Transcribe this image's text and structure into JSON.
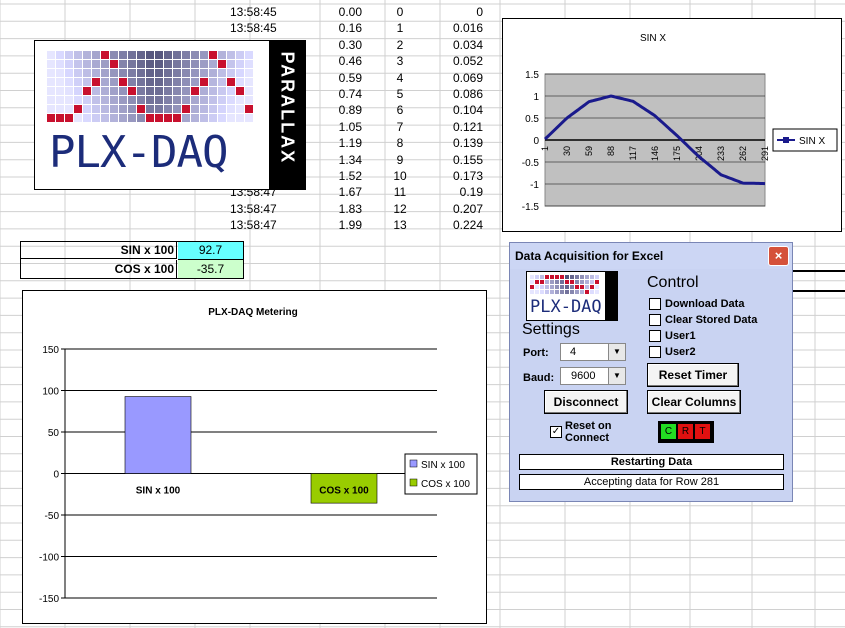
{
  "sheet_rows": [
    {
      "time": "13:58:45",
      "v": "0.00",
      "n": "0",
      "c": "0"
    },
    {
      "time": "13:58:45",
      "v": "0.16",
      "n": "1",
      "c": "0.016"
    },
    {
      "time": "",
      "v": "0.30",
      "n": "2",
      "c": "0.034"
    },
    {
      "time": "",
      "v": "0.46",
      "n": "3",
      "c": "0.052"
    },
    {
      "time": "",
      "v": "0.59",
      "n": "4",
      "c": "0.069"
    },
    {
      "time": "",
      "v": "0.74",
      "n": "5",
      "c": "0.086"
    },
    {
      "time": "",
      "v": "0.89",
      "n": "6",
      "c": "0.104"
    },
    {
      "time": "",
      "v": "1.05",
      "n": "7",
      "c": "0.121"
    },
    {
      "time": "",
      "v": "1.19",
      "n": "8",
      "c": "0.139"
    },
    {
      "time": "",
      "v": "1.34",
      "n": "9",
      "c": "0.155"
    },
    {
      "time": "",
      "v": "1.52",
      "n": "10",
      "c": "0.173"
    },
    {
      "time": "13:58:47",
      "v": "1.67",
      "n": "11",
      "c": "0.19"
    },
    {
      "time": "13:58:47",
      "v": "1.83",
      "n": "12",
      "c": "0.207"
    },
    {
      "time": "13:58:47",
      "v": "1.99",
      "n": "13",
      "c": "0.224"
    }
  ],
  "logo": {
    "text": "PLX-DAQ",
    "brand": "PARALLAX"
  },
  "readouts": {
    "sin_label": "SIN x 100",
    "sin_value": "92.7",
    "cos_label": "COS x 100",
    "cos_value": "-35.7"
  },
  "chart_data": [
    {
      "type": "line",
      "title": "SIN X",
      "x": [
        1,
        30,
        59,
        88,
        117,
        146,
        175,
        204,
        233,
        262,
        291
      ],
      "series": [
        {
          "name": "SIN X",
          "values": [
            0.02,
            0.5,
            0.87,
            1.0,
            0.88,
            0.55,
            0.1,
            -0.38,
            -0.79,
            -0.98,
            -0.99
          ]
        }
      ],
      "xlabels": [
        "1",
        "30",
        "59",
        "88",
        "117",
        "146",
        "175",
        "204",
        "233",
        "262",
        "291"
      ],
      "yticks": [
        "1.5",
        "1",
        "0.5",
        "0",
        "-0.5",
        "-1",
        "-1.5"
      ],
      "ylim": [
        -1.5,
        1.5
      ],
      "legend": "right",
      "colors": {
        "line": "#1a1a8c",
        "plot_bg": "#c0c0c0"
      }
    },
    {
      "type": "bar",
      "title": "PLX-DAQ Metering",
      "categories": [
        "SIN x 100",
        "COS x 100"
      ],
      "series": [
        {
          "name": "SIN x 100",
          "values": [
            92.7
          ]
        },
        {
          "name": "COS x 100",
          "values": [
            -35.7
          ]
        }
      ],
      "yticks": [
        "150",
        "100",
        "50",
        "0",
        "-50",
        "-100",
        "-150"
      ],
      "ylim": [
        -150,
        150
      ],
      "legend": "right",
      "colors": {
        "sin": "#9999ff",
        "cos": "#99cc00"
      }
    }
  ],
  "dialog": {
    "title": "Data Acquisition for Excel",
    "close_icon": "×",
    "settings_label": "Settings",
    "control_label": "Control",
    "port_label": "Port:",
    "port_value": "4",
    "baud_label": "Baud:",
    "baud_value": "9600",
    "disconnect": "Disconnect",
    "reset_connect_line1": "Reset on",
    "reset_connect_line2": "Connect",
    "download_data": "Download Data",
    "clear_stored": "Clear Stored Data",
    "user1": "User1",
    "user2": "User2",
    "reset_timer": "Reset Timer",
    "clear_columns": "Clear Columns",
    "indicators": [
      "C",
      "R",
      "T"
    ],
    "status1": "Restarting Data",
    "status2": "Accepting data for Row 281"
  }
}
